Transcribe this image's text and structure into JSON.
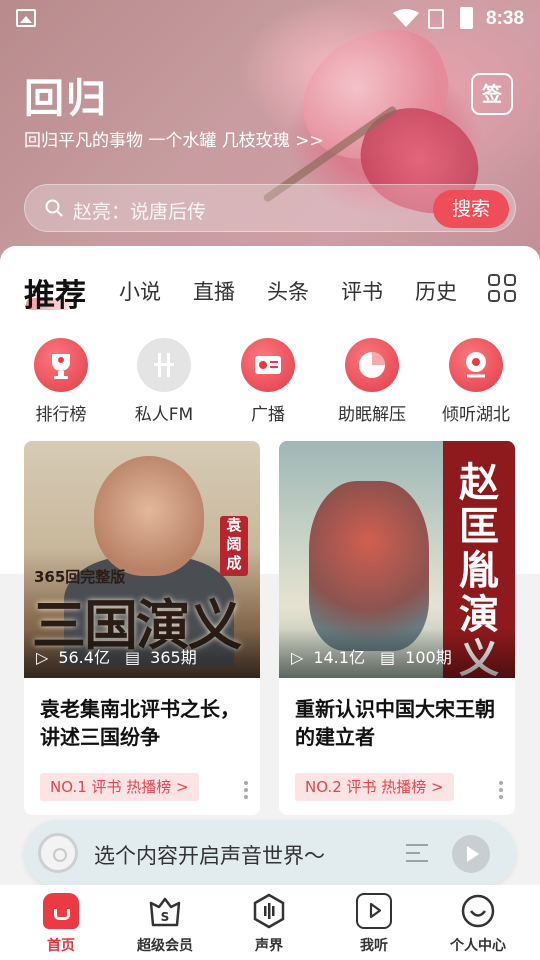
{
  "status_bar": {
    "time": "8:38"
  },
  "header": {
    "title": "回归",
    "subtitle": "回归平凡的事物 一个水罐 几枝玫瑰 >>",
    "sign_label": "签"
  },
  "search": {
    "placeholder": "赵亮：说唐后传",
    "button_label": "搜索"
  },
  "tabs": [
    {
      "label": "推荐",
      "active": true
    },
    {
      "label": "小说"
    },
    {
      "label": "直播"
    },
    {
      "label": "头条"
    },
    {
      "label": "评书"
    },
    {
      "label": "历史"
    }
  ],
  "categories": [
    {
      "label": "排行榜",
      "icon": "trophy-icon"
    },
    {
      "label": "私人FM",
      "icon": "fm-icon"
    },
    {
      "label": "广播",
      "icon": "radio-icon"
    },
    {
      "label": "助眠解压",
      "icon": "sleep-icon"
    },
    {
      "label": "倾听湖北",
      "icon": "location-icon"
    }
  ],
  "cards": [
    {
      "cover_title": "三国演义",
      "cover_banner": "365回完整版",
      "cover_seal": "袁阔成",
      "plays": "56.4亿",
      "episodes": "365期",
      "title": "袁老集南北评书之长，讲述三国纷争",
      "rank": "NO.1 评书 热播榜 >"
    },
    {
      "cover_title": "赵匡胤演义",
      "plays": "14.1亿",
      "episodes": "100期",
      "title": "重新认识中国大宋王朝的建立者",
      "rank": "NO.2 评书 热播榜 >"
    }
  ],
  "player": {
    "prompt": "选个内容开启声音世界～"
  },
  "bottom_nav": [
    {
      "label": "首页",
      "active": true
    },
    {
      "label": "超级会员"
    },
    {
      "label": "声界"
    },
    {
      "label": "我听"
    },
    {
      "label": "个人中心"
    }
  ],
  "colors": {
    "accent": "#ec3a44",
    "rank_tag_bg": "#fde4e4"
  }
}
